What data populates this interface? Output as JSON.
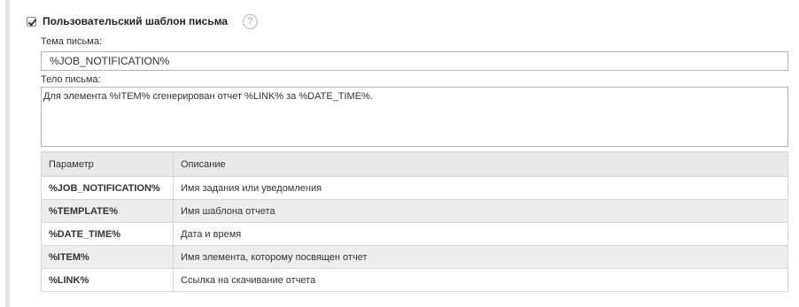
{
  "custom_template": {
    "checked": true,
    "label": "Пользовательский шаблон письма",
    "help_icon": "?"
  },
  "subject": {
    "label": "Тема письма:",
    "value": "%JOB_NOTIFICATION%"
  },
  "body": {
    "label": "Тело письма:",
    "value": "Для элемента %ITEM% сгенерирован отчет %LINK% за %DATE_TIME%."
  },
  "params_table": {
    "headers": [
      "Параметр",
      "Описание"
    ],
    "rows": [
      {
        "param": "%JOB_NOTIFICATION%",
        "description": "Имя задания или уведомления"
      },
      {
        "param": "%TEMPLATE%",
        "description": "Имя шаблона отчета"
      },
      {
        "param": "%DATE_TIME%",
        "description": "Дата и время"
      },
      {
        "param": "%ITEM%",
        "description": "Имя элемента, которому посвящен отчет"
      },
      {
        "param": "%LINK%",
        "description": "Ссылка на скачивание отчета"
      }
    ]
  }
}
